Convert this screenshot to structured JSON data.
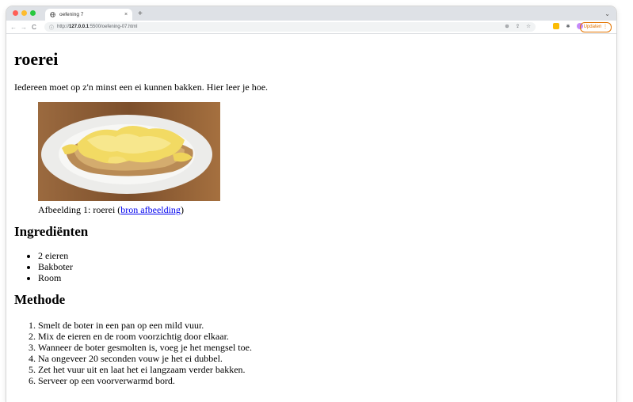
{
  "browser": {
    "tab_title": "oefening 7",
    "tab_close": "×",
    "new_tab": "+",
    "tab_menu": "⌄",
    "url_prefix": "http://",
    "url_host": "127.0.0.1",
    "url_rest": ":5500/oefening-07.html",
    "update_label": "Updaten",
    "traffic_colors": [
      "#ff5f57",
      "#febc2e",
      "#28c840"
    ]
  },
  "page": {
    "heading": "roerei",
    "intro": "Iedereen moet op z'n minst een ei kunnen bakken. Hier leer je hoe.",
    "caption_text": "Afbeelding 1: roerei (",
    "caption_link": "bron afbeelding",
    "caption_end": ")",
    "ingredients_heading": "Ingrediënten",
    "ingredients": [
      "2 eieren",
      "Bakboter",
      "Room"
    ],
    "method_heading": "Methode",
    "steps": [
      "Smelt de boter in een pan op een mild vuur.",
      "Mix de eieren en de room voorzichtig door elkaar.",
      "Wanneer de boter gesmolten is, voeg je het mengsel toe.",
      "Na ongeveer 20 seconden vouw je het ei dubbel.",
      "Zet het vuur uit en laat het ei langzaam verder bakken.",
      "Serveer op een voorverwarmd bord."
    ]
  }
}
